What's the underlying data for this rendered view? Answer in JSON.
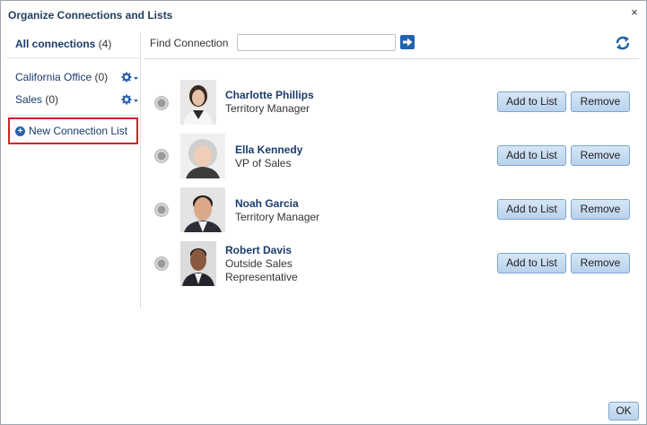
{
  "dialog": {
    "title": "Organize Connections and Lists",
    "close_glyph": "×"
  },
  "sidebar": {
    "all_connections": {
      "label": "All connections",
      "count": "(4)"
    },
    "lists": [
      {
        "label": "California Office",
        "count": "(0)",
        "menu_icon": "gear-icon"
      },
      {
        "label": "Sales",
        "count": "(0)",
        "menu_icon": "gear-icon"
      }
    ],
    "new_list_label": "New Connection List"
  },
  "search": {
    "label": "Find Connection",
    "value": "",
    "placeholder": ""
  },
  "connections": [
    {
      "name": "Charlotte Phillips",
      "title_lines": [
        "Territory Manager"
      ],
      "add_label": "Add to List",
      "remove_label": "Remove"
    },
    {
      "name": "Ella Kennedy",
      "title_lines": [
        "VP of Sales"
      ],
      "add_label": "Add to List",
      "remove_label": "Remove"
    },
    {
      "name": "Noah Garcia",
      "title_lines": [
        "Territory Manager"
      ],
      "add_label": "Add to List",
      "remove_label": "Remove"
    },
    {
      "name": "Robert Davis",
      "title_lines": [
        "Outside Sales",
        "Representative"
      ],
      "add_label": "Add to List",
      "remove_label": "Remove"
    }
  ],
  "footer": {
    "ok_label": "OK"
  },
  "colors": {
    "link": "#1a3b6b",
    "accent": "#1f62b0",
    "highlight_border": "#d6202a"
  }
}
